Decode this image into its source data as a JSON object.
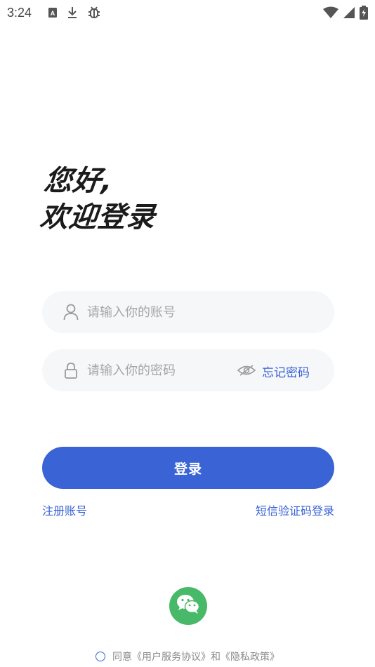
{
  "status_bar": {
    "time": "3:24",
    "icons": [
      "a-notification-icon",
      "download-icon",
      "bug-icon",
      "wifi-icon",
      "signal-icon",
      "battery-icon"
    ]
  },
  "greeting": {
    "line1": "您好,",
    "line2": "欢迎登录"
  },
  "account": {
    "placeholder": "请输入你的账号",
    "value": ""
  },
  "password": {
    "placeholder": "请输入你的密码",
    "value": "",
    "forgot_label": "忘记密码"
  },
  "login_button": {
    "label": "登录"
  },
  "links": {
    "register": "注册账号",
    "sms_login": "短信验证码登录"
  },
  "agreement": {
    "prefix": "同意",
    "user_agreement": "《用户服务协议》",
    "conjunction": "和",
    "privacy_policy": "《隐私政策》"
  },
  "colors": {
    "primary": "#3a63d6",
    "link": "#3862d6",
    "wechat": "#48b968",
    "input_bg": "#f6f7f9",
    "placeholder": "#a6a6a6"
  }
}
